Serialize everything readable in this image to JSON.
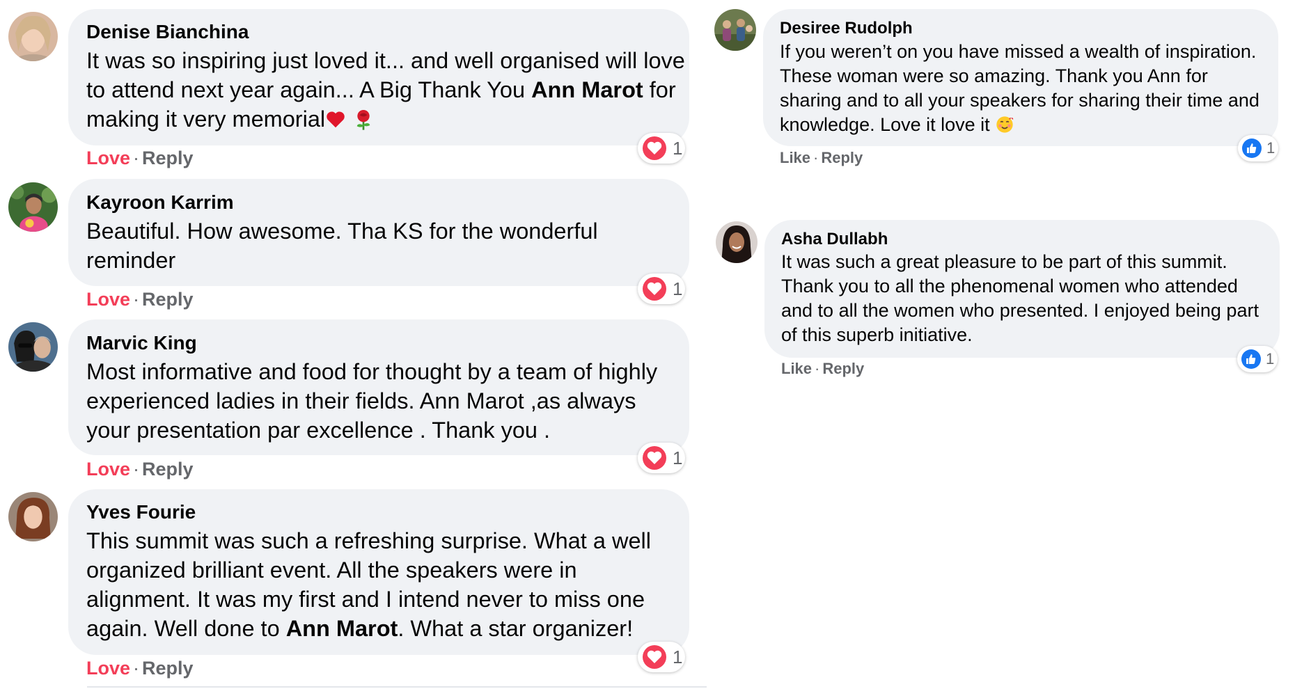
{
  "comments": [
    {
      "author": "Denise Bianchina",
      "text_parts": [
        "It was so inspiring just loved it... and well organised will love to attend next year again... A Big Thank You ",
        "Ann Marot",
        " for making it very memorial"
      ],
      "emojis": [
        "heart-emoji",
        "rose-emoji"
      ],
      "action_primary": "Love",
      "action_secondary": "Reply",
      "reaction_icon": "love-reaction-icon",
      "reaction_count": "1"
    },
    {
      "author": "Kayroon Karrim",
      "text": "Beautiful. How awesome. Tha KS for the wonderful reminder",
      "action_primary": "Love",
      "action_secondary": "Reply",
      "reaction_icon": "love-reaction-icon",
      "reaction_count": "1"
    },
    {
      "author": "Marvic King",
      "text": "Most informative and food for thought by a team of highly experienced ladies in their fields. Ann Marot ,as always your presentation par excellence . Thank you .",
      "action_primary": "Love",
      "action_secondary": "Reply",
      "reaction_icon": "love-reaction-icon",
      "reaction_count": "1"
    },
    {
      "author": "Yves Fourie",
      "text_parts": [
        "This summit was such a refreshing surprise. What a well organized brilliant event. All the speakers were in alignment. It was my first and I intend never to miss one again. Well done to ",
        "Ann Marot",
        ". What a star organizer!"
      ],
      "action_primary": "Love",
      "action_secondary": "Reply",
      "reaction_icon": "love-reaction-icon",
      "reaction_count": "1"
    },
    {
      "author": "Desiree Rudolph",
      "text": "If you weren’t on you have missed a wealth of inspiration. These woman were so amazing. Thank you Ann for sharing and to all your speakers for sharing their time and knowledge. Love it love it",
      "emojis": [
        "smiling-face-with-hearts-emoji"
      ],
      "action_primary": "Like",
      "action_secondary": "Reply",
      "reaction_icon": "like-reaction-icon",
      "reaction_count": "1"
    },
    {
      "author": "Asha Dullabh",
      "text": "It was such a great pleasure to be part of this summit. Thank you to all the phenomenal women who attended and to all the women who presented. I enjoyed being part of this superb initiative.",
      "action_primary": "Like",
      "action_secondary": "Reply",
      "reaction_icon": "like-reaction-icon",
      "reaction_count": "1"
    }
  ],
  "separator": "·",
  "colors": {
    "bubble": "#f0f2f5",
    "love": "#f33e58",
    "like": "#1877f2",
    "muted": "#65676b"
  }
}
